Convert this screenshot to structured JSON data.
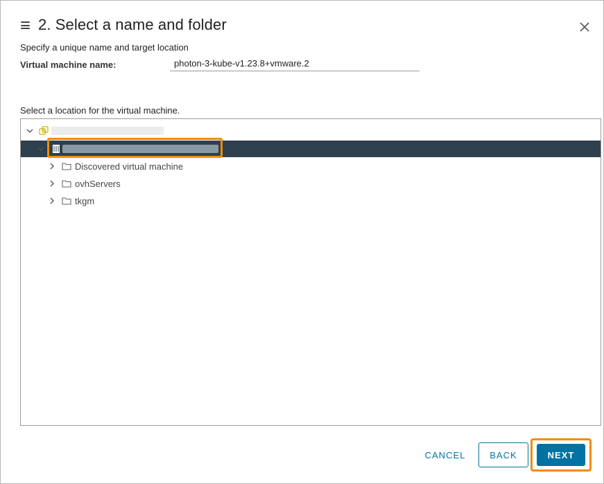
{
  "dialog": {
    "title": "2. Select a name and folder",
    "subtitle": "Specify a unique name and target location",
    "vm_name_label": "Virtual machine name:",
    "vm_name_value": "photon-3-kube-v1.23.8+vmware.2",
    "location_label": "Select a location for the virtual machine."
  },
  "tree": {
    "root": {
      "label": "",
      "icon": "vcenter-icon",
      "expanded": true
    },
    "datacenter": {
      "label": "",
      "icon": "datacenter-icon",
      "expanded": true,
      "selected": true
    },
    "folders": [
      {
        "label": "Discovered virtual machine",
        "icon": "folder-icon"
      },
      {
        "label": "ovhServers",
        "icon": "folder-icon"
      },
      {
        "label": "tkgm",
        "icon": "folder-icon"
      }
    ]
  },
  "footer": {
    "cancel_label": "CANCEL",
    "back_label": "BACK",
    "next_label": "NEXT"
  },
  "colors": {
    "accent": "#0072a3",
    "selected_row": "#2e3f4d",
    "highlight": "#f28c00"
  }
}
